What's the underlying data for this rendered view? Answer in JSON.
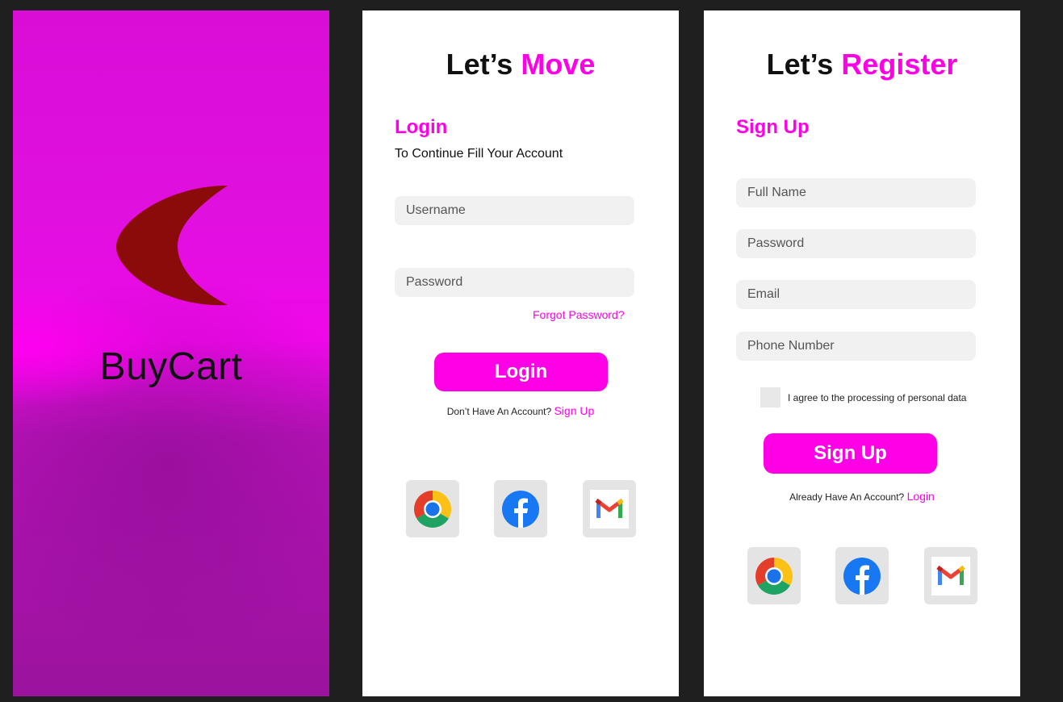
{
  "splash": {
    "brand": "BuyCart",
    "colors": {
      "logo": "#8b0a0a",
      "text": "#111111"
    },
    "logo_icon": "crescent-icon"
  },
  "login": {
    "title_prefix": "Let’s",
    "title_accent": "Move",
    "section_title": "Login",
    "subtitle": "To Continue Fill Your Account",
    "username_placeholder": "Username",
    "password_placeholder": "Password",
    "forgot_password": "Forgot Password?",
    "button_label": "Login",
    "no_account_text": "Don’t Have An Account?",
    "signup_link": "Sign Up"
  },
  "register": {
    "title_prefix": "Let’s",
    "title_accent": "Register",
    "section_title": "Sign Up",
    "fullname_placeholder": "Full Name",
    "password_placeholder": "Password",
    "email_placeholder": "Email",
    "phone_placeholder": "Phone Number",
    "agree_text": "I agree to the processing of personal data",
    "button_label": "Sign Up",
    "have_account_text": "Already Have An Account?",
    "login_link": "Login"
  },
  "social": [
    "chrome-icon",
    "facebook-icon",
    "gmail-icon"
  ],
  "colors": {
    "accent": "#ff00e6",
    "field_bg": "#f1f1f1",
    "social_bg": "#e4e4e4",
    "canvas": "#1f1f1f"
  }
}
